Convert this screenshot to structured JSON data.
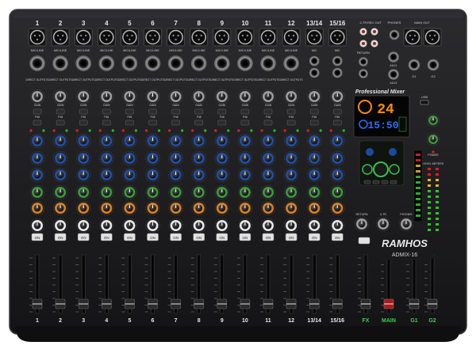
{
  "channels": [
    "1",
    "2",
    "3",
    "4",
    "5",
    "6",
    "7",
    "8",
    "9",
    "10",
    "11",
    "12",
    "13/14",
    "15/16"
  ],
  "mono_input_label": "MIC/LINE",
  "direct_out_label": "DIRECT OUTPUTS",
  "stereo_input_label": "MIC",
  "knob_labels": {
    "gain": "GAIN",
    "p48": "P48",
    "hpf": "HPF",
    "high": "HIGH",
    "mid": "MID",
    "low": "LOW",
    "aux": "AUX",
    "fx": "FX",
    "pan": "PAN"
  },
  "on_button_label": "ON",
  "brand": {
    "name": "RAMHOS",
    "model": "ADMIX-16",
    "panel_title": "Professional Mixer"
  },
  "master_section": {
    "jack_labels": [
      "2-TR",
      "REC OUT",
      "PHONES",
      "MAIN OUT"
    ],
    "return_label": "RETURN",
    "aux_labels": [
      "AUX1",
      "AUX2"
    ],
    "group_labels": [
      "G1",
      "G2"
    ],
    "knob_labels": [
      "RETURN",
      "2-TR",
      "PHONES"
    ],
    "power_label": "POWER",
    "meter_label": "LEVEL METERS"
  },
  "display": {
    "fx_number": "24",
    "time": "15:50",
    "usb_label": "USB"
  },
  "bottom_labels": [
    "1",
    "2",
    "3",
    "4",
    "5",
    "6",
    "7",
    "8",
    "9",
    "10",
    "11",
    "12",
    "13/14",
    "15/16",
    "FX",
    "MAIN",
    "G1",
    "G2"
  ],
  "colors": {
    "chassis": "#1c1c1e",
    "panel": "#232326",
    "knob_blue": "#1f4fa8",
    "knob_green": "#3a9a3a",
    "knob_orange": "#d9801f",
    "knob_white": "#e6e6e6",
    "display_orange": "#ff8a00",
    "display_green": "#38c048",
    "display_blue": "#2a6cff"
  }
}
